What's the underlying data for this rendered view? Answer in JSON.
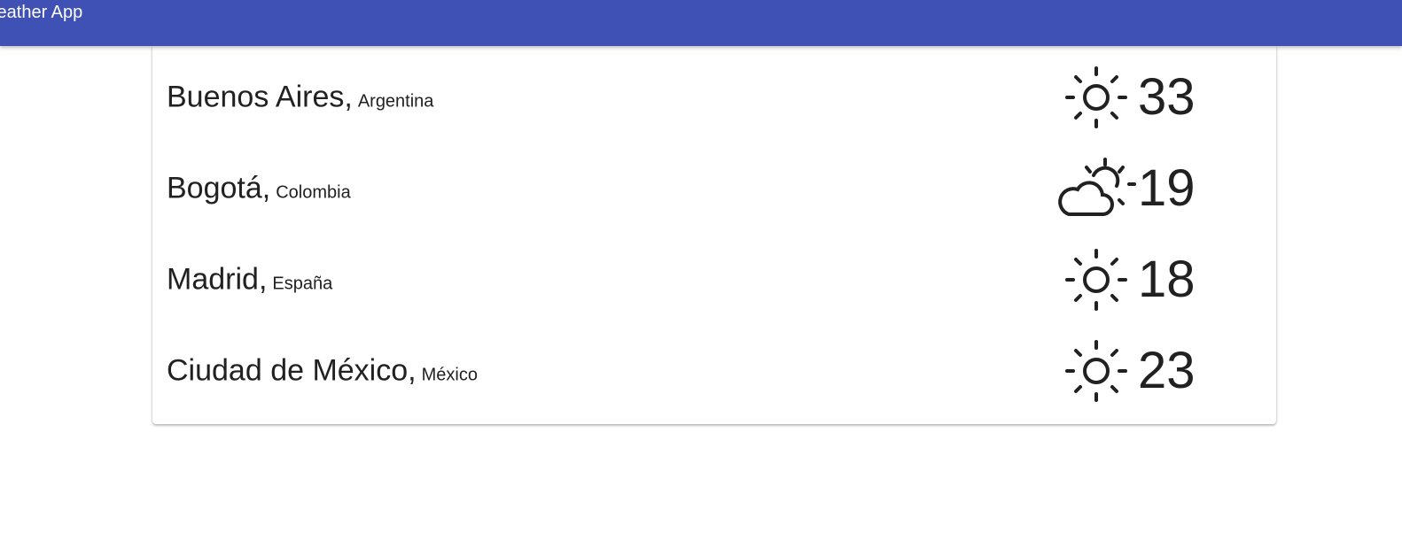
{
  "app": {
    "title": "Weather App"
  },
  "cities": [
    {
      "city": "Buenos Aires",
      "country": "Argentina",
      "temp": "33",
      "icon": "sun-icon"
    },
    {
      "city": "Bogotá",
      "country": "Colombia",
      "temp": "19",
      "icon": "partly-cloudy-icon"
    },
    {
      "city": "Madrid",
      "country": "España",
      "temp": "18",
      "icon": "sun-icon"
    },
    {
      "city": "Ciudad de México",
      "country": "México",
      "temp": "23",
      "icon": "sun-icon"
    }
  ],
  "colors": {
    "appbar": "#3f51b5",
    "text": "#212121"
  }
}
